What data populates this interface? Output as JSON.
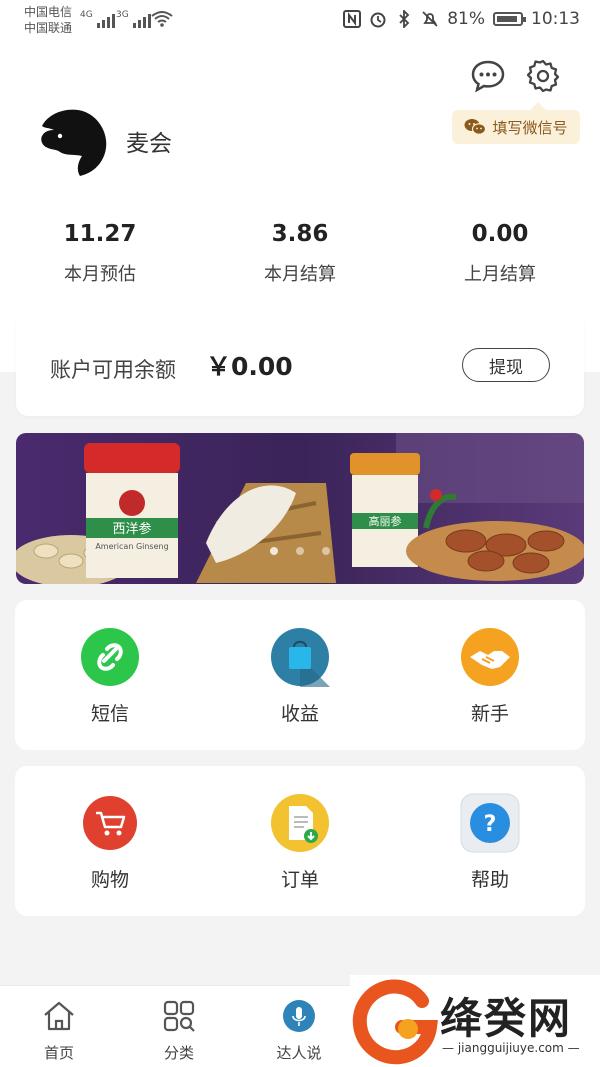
{
  "status_bar": {
    "carrier_1": "中国电信",
    "carrier_2": "中国联通",
    "net_1": "4G",
    "net_2": "3G",
    "battery": "81%",
    "time": "10:13"
  },
  "header": {
    "wechat_prompt": "填写微信号",
    "username": "麦会"
  },
  "stats": [
    {
      "value": "11.27",
      "label": "本月预估"
    },
    {
      "value": "3.86",
      "label": "本月结算"
    },
    {
      "value": "0.00",
      "label": "上月结算"
    }
  ],
  "balance": {
    "label": "账户可用余额",
    "amount": "￥0.00",
    "withdraw_label": "提现"
  },
  "banner": {
    "product_1": "西洋参",
    "product_1_sub": "American Ginseng",
    "product_2": "高丽参"
  },
  "grid_1": [
    {
      "label": "短信",
      "icon": "link-icon",
      "color": "#2cc64a"
    },
    {
      "label": "收益",
      "icon": "bag-icon",
      "color": "#2e7fa6"
    },
    {
      "label": "新手",
      "icon": "handshake-icon",
      "color": "#f4a21f"
    }
  ],
  "grid_2": [
    {
      "label": "购物",
      "icon": "cart-icon",
      "color": "#e0402e"
    },
    {
      "label": "订单",
      "icon": "document-icon",
      "color": "#f2c230"
    },
    {
      "label": "帮助",
      "icon": "question-icon",
      "color": "#2a8ee0"
    }
  ],
  "bottom_nav": [
    {
      "label": "首页",
      "icon": "home-icon"
    },
    {
      "label": "分类",
      "icon": "category-icon"
    },
    {
      "label": "达人说",
      "icon": "microphone-icon"
    }
  ],
  "watermark": {
    "text": "绛癸网",
    "url": "jiangguijiuye.com"
  }
}
